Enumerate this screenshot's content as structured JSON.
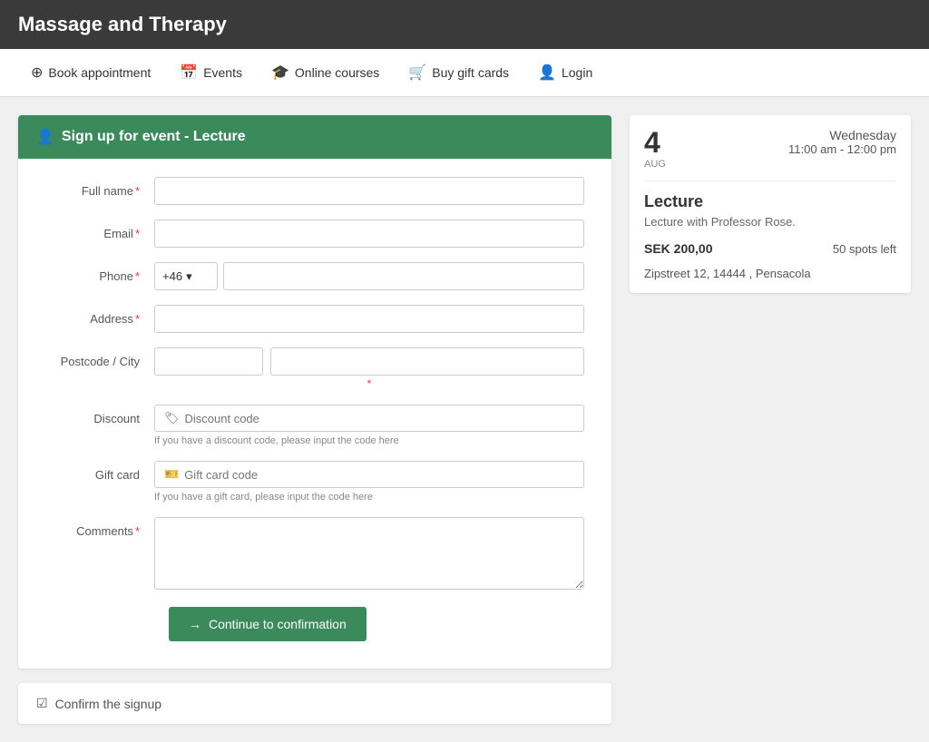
{
  "header": {
    "title": "Massage and Therapy"
  },
  "nav": {
    "items": [
      {
        "id": "book-appointment",
        "label": "Book appointment",
        "icon": "⊕"
      },
      {
        "id": "events",
        "label": "Events",
        "icon": "📅"
      },
      {
        "id": "online-courses",
        "label": "Online courses",
        "icon": "🎓"
      },
      {
        "id": "buy-gift-cards",
        "label": "Buy gift cards",
        "icon": "🛒"
      },
      {
        "id": "login",
        "label": "Login",
        "icon": "👤"
      }
    ]
  },
  "form": {
    "header": "Sign up for event - Lecture",
    "header_icon": "👤",
    "fields": {
      "full_name_label": "Full name",
      "email_label": "Email",
      "phone_label": "Phone",
      "phone_code": "+46",
      "address_label": "Address",
      "postcode_city_label": "Postcode / City",
      "discount_label": "Discount",
      "discount_placeholder": "Discount code",
      "discount_hint": "If you have a discount code, please input the code here",
      "gift_card_label": "Gift card",
      "gift_card_placeholder": "Gift card code",
      "gift_card_hint": "If you have a gift card, please input the code here",
      "comments_label": "Comments"
    },
    "button": {
      "label": "Continue to confirmation"
    }
  },
  "event_card": {
    "date_num": "4",
    "date_month": "AUG",
    "date_day": "Wednesday",
    "date_time": "11:00 am - 12:00 pm",
    "title": "Lecture",
    "description": "Lecture with Professor Rose.",
    "price": "SEK 200,00",
    "spots": "50 spots left",
    "address": "Zipstreet 12, 14444 , Pensacola"
  },
  "confirm_section": {
    "icon": "✅",
    "label": "Confirm the signup"
  }
}
